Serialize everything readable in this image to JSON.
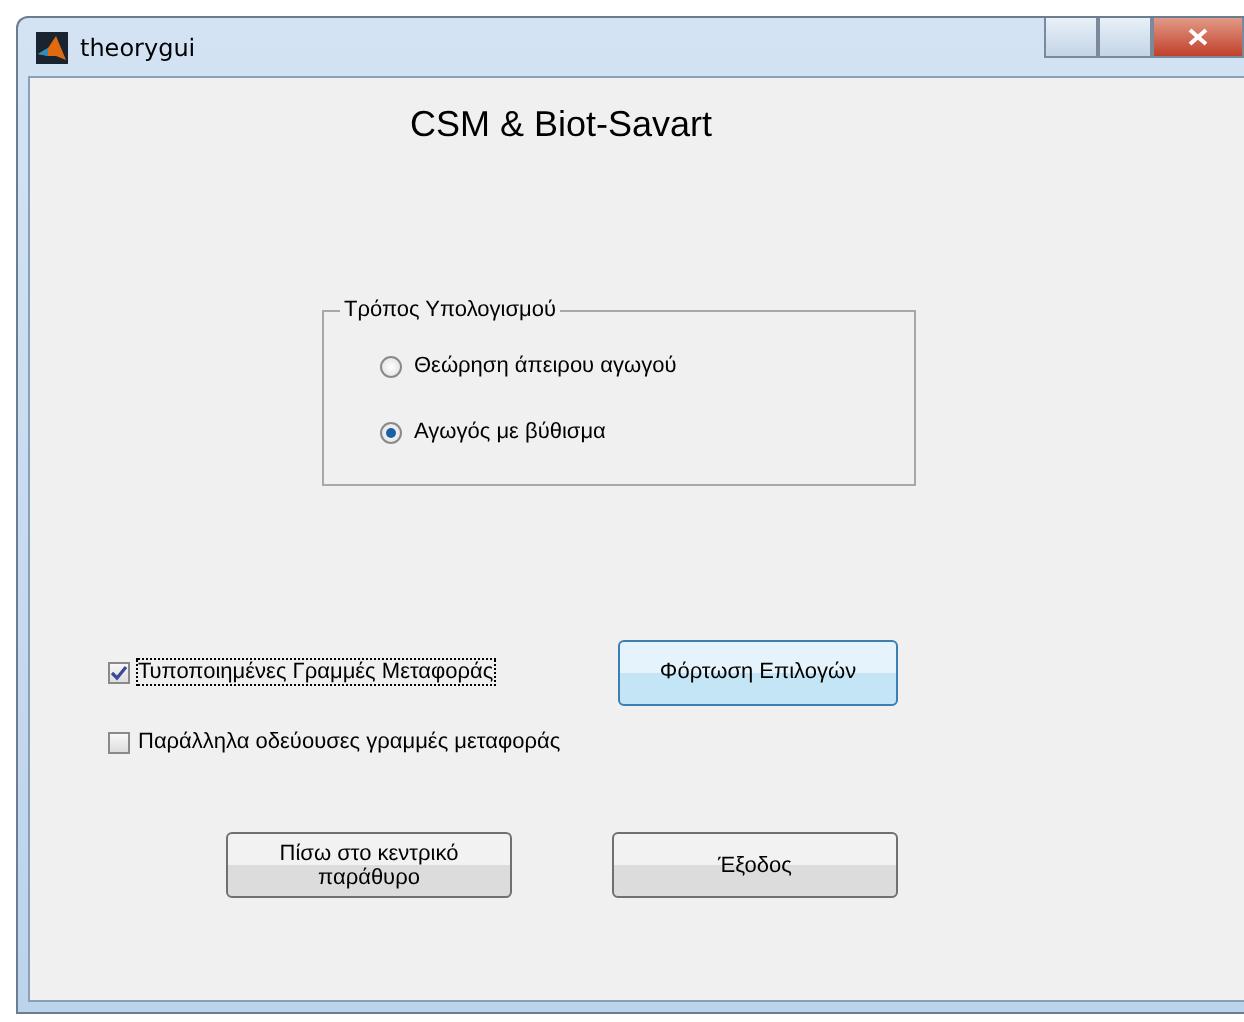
{
  "window": {
    "title": "theorygui"
  },
  "heading": "CSM & Biot-Savart",
  "group": {
    "title": "Τρόπος Υπολογισμού",
    "options": [
      {
        "label": "Θεώρηση άπειρου αγωγού",
        "selected": false
      },
      {
        "label": "Αγωγός με βύθισμα",
        "selected": true
      }
    ]
  },
  "checkboxes": [
    {
      "label": "Τυποποιημένες Γραμμές Μεταφοράς",
      "checked": true,
      "focused": true
    },
    {
      "label": "Παράλληλα οδεύουσες γραμμές μεταφοράς",
      "checked": false,
      "focused": false
    }
  ],
  "load_button": {
    "label": "Φόρτωση Επιλογών",
    "highlighted": true
  },
  "buttons": [
    {
      "label": "Πίσω στο κεντρικό παράθυρο"
    },
    {
      "label": "Έξοδος"
    }
  ]
}
